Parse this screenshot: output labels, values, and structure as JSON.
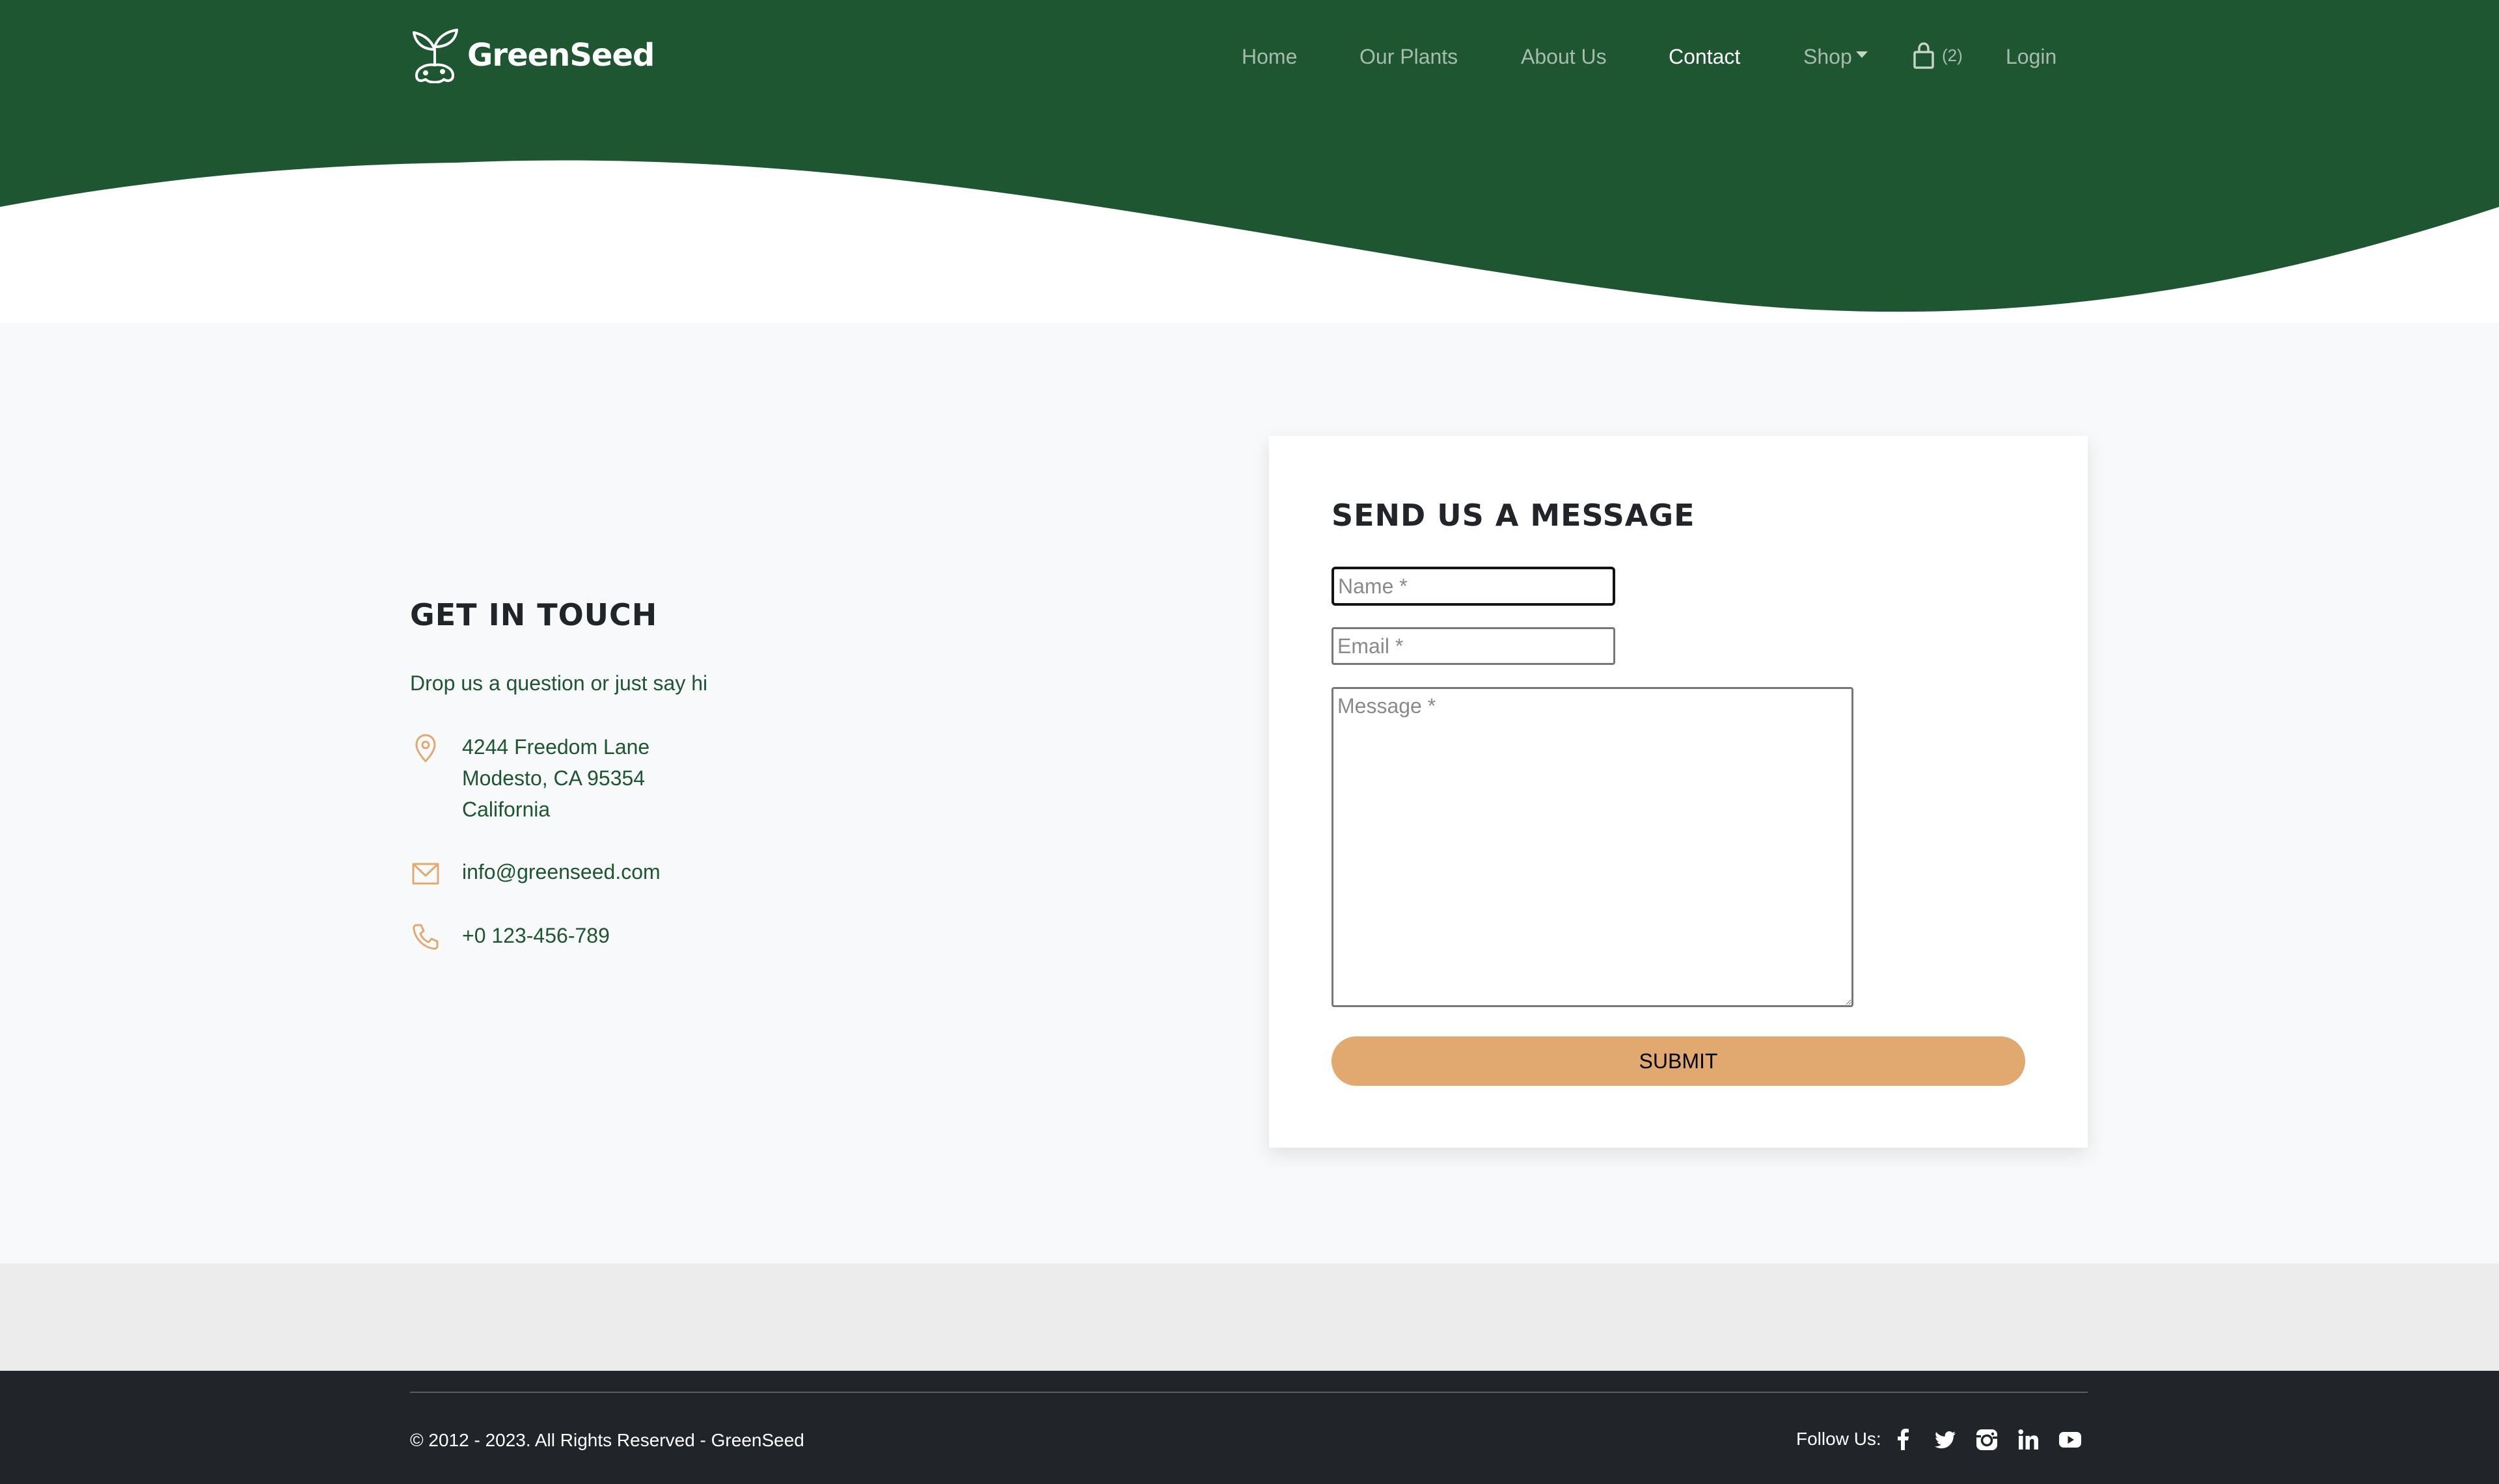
{
  "nav": {
    "brand": "GreenSeed",
    "links": [
      {
        "label": "Home",
        "active": false
      },
      {
        "label": "Our Plants",
        "active": false
      },
      {
        "label": "About Us",
        "active": false
      },
      {
        "label": "Contact",
        "active": true
      },
      {
        "label": "Shop",
        "active": false
      },
      {
        "label": "Login",
        "active": false
      }
    ],
    "cart_count": "(2)"
  },
  "get_in_touch": {
    "title": "GET IN TOUCH",
    "subtitle": "Drop us a question or just say hi",
    "address": [
      "4244 Freedom Lane",
      "Modesto, CA 95354",
      "California"
    ],
    "email": "info@greenseed.com",
    "phone": "+0 123-456-789"
  },
  "form": {
    "title": "SEND US A MESSAGE",
    "name_placeholder": "Name *",
    "email_placeholder": "Email *",
    "message_placeholder": "Message *",
    "submit_label": "SUBMIT"
  },
  "footer": {
    "copyright": "© 2012 - 2023. All Rights Reserved - GreenSeed",
    "follow_label": "Follow Us:",
    "social": [
      "facebook-icon",
      "twitter-icon",
      "instagram-icon",
      "linkedin-icon",
      "youtube-icon"
    ]
  },
  "colors": {
    "header_green": "#1e5631",
    "accent": "#e1a96f",
    "footer_dark": "#212529",
    "text_green": "#1e5631"
  }
}
